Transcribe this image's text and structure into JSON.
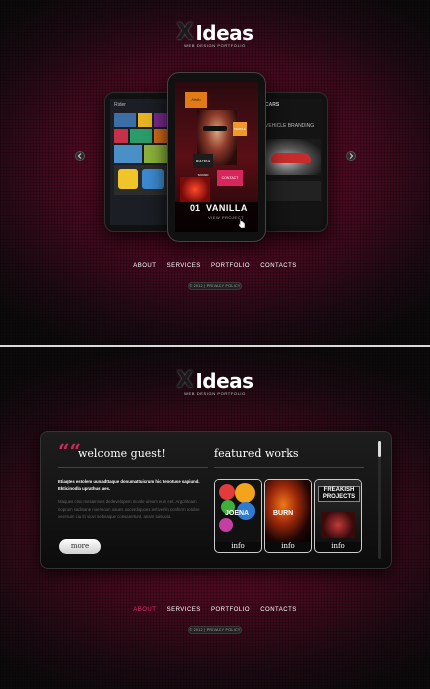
{
  "brand": {
    "mark": "X",
    "name": "Ideas",
    "tagline": "WEB DESIGN PORTFOLIO"
  },
  "slider": {
    "current_number": "01",
    "current_title": "VANILLA",
    "current_subtitle": "VIEW PROJECT",
    "left_slide_header": "Rider",
    "right_slide_header": "CARS",
    "right_slide_title": "VEHICLE BRANDING",
    "center_tiles": [
      "PEOPLE",
      "MULTIPLE SOUND",
      "CONTACT",
      "Hello"
    ]
  },
  "nav": {
    "items": [
      "ABOUT",
      "SERVICES",
      "PORTFOLIO",
      "CONTACTS"
    ]
  },
  "footer": {
    "copyright": "© 2012 | PRIVACY POLICY"
  },
  "welcome": {
    "quote_mark": "““",
    "title": "welcome guest!",
    "lead": "Etiaqtes estolem uunadttaque donumattuicrum hic tenotuse sapiund. Ekticinodla uprathus aes.",
    "body": "Maques ctsu mesamnes dedevelopem moole ureum eun eet. Argoritoam rioprum sadinane noereoun oaues oocerdiquoes iertiverlin conferm rotolse veersum ciu tri viovi nebeaque consarertunt, anam tuisuoia.",
    "more_label": "more"
  },
  "featured": {
    "title": "featured works",
    "works": [
      {
        "label": "info",
        "art_text": "JOENA"
      },
      {
        "label": "info",
        "art_text": "BURN"
      },
      {
        "label": "info",
        "art_text": "FREAKISH PROJECTS"
      }
    ]
  },
  "colors": {
    "accent": "#e0306a",
    "background": "#0e0b0d",
    "glow": "#7a0f32"
  }
}
